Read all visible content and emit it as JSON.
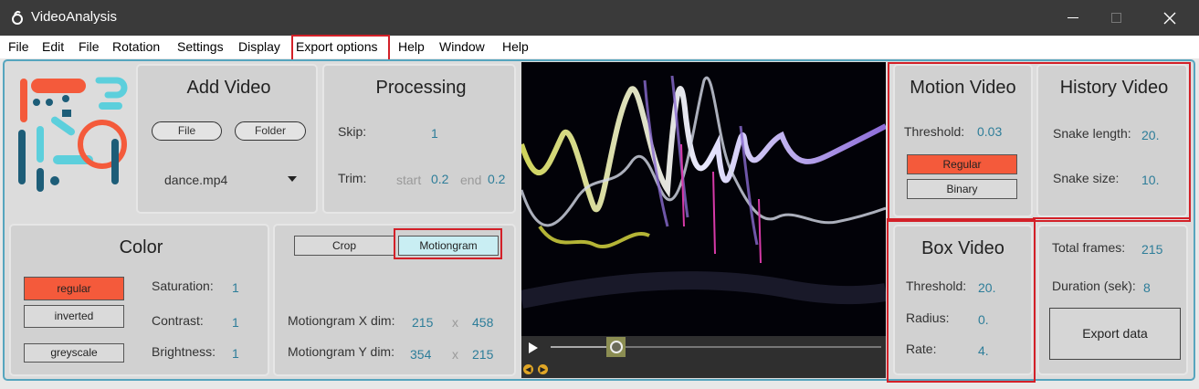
{
  "app": {
    "title": "VideoAnalysis"
  },
  "menu": [
    "File",
    "Edit",
    "File",
    "Rotation",
    "Settings",
    "Display",
    "Export options",
    "Help",
    "Window",
    "Help"
  ],
  "add_video": {
    "title": "Add Video",
    "file_btn": "File",
    "folder_btn": "Folder",
    "selected": "dance.mp4"
  },
  "processing": {
    "title": "Processing",
    "skip_label": "Skip:",
    "skip_value": "1",
    "trim_label": "Trim:",
    "start_label": "start",
    "start_value": "0.2",
    "end_label": "end",
    "end_value": "0.2"
  },
  "color": {
    "title": "Color",
    "regular": "regular",
    "inverted": "inverted",
    "greyscale": "greyscale",
    "saturation_label": "Saturation:",
    "saturation": "1",
    "contrast_label": "Contrast:",
    "contrast": "1",
    "brightness_label": "Brightness:",
    "brightness": "1"
  },
  "mode": {
    "crop": "Crop",
    "motiongram": "Motiongram",
    "x_label": "Motiongram X dim:",
    "x_w": "215",
    "x_sep": "x",
    "x_h": "458",
    "y_label": "Motiongram Y dim:",
    "y_w": "354",
    "y_sep": "x",
    "y_h": "215"
  },
  "motion_video": {
    "title": "Motion Video",
    "threshold_label": "Threshold:",
    "threshold": "0.03",
    "regular": "Regular",
    "binary": "Binary"
  },
  "history_video": {
    "title": "History Video",
    "snake_length_label": "Snake length:",
    "snake_length": "20.",
    "snake_size_label": "Snake size:",
    "snake_size": "10."
  },
  "box_video": {
    "title": "Box Video",
    "threshold_label": "Threshold:",
    "threshold": "20.",
    "radius_label": "Radius:",
    "radius": "0.",
    "rate_label": "Rate:",
    "rate": "4."
  },
  "stats": {
    "frames_label": "Total frames:",
    "frames": "215",
    "duration_label": "Duration (sek):",
    "duration": "8",
    "export": "Export data"
  },
  "player": {
    "progress": 0.18
  },
  "colors": {
    "accent": "#2d7d99",
    "active": "#f45a3b",
    "highlight": "#d32028",
    "frame": "#56a5be"
  }
}
